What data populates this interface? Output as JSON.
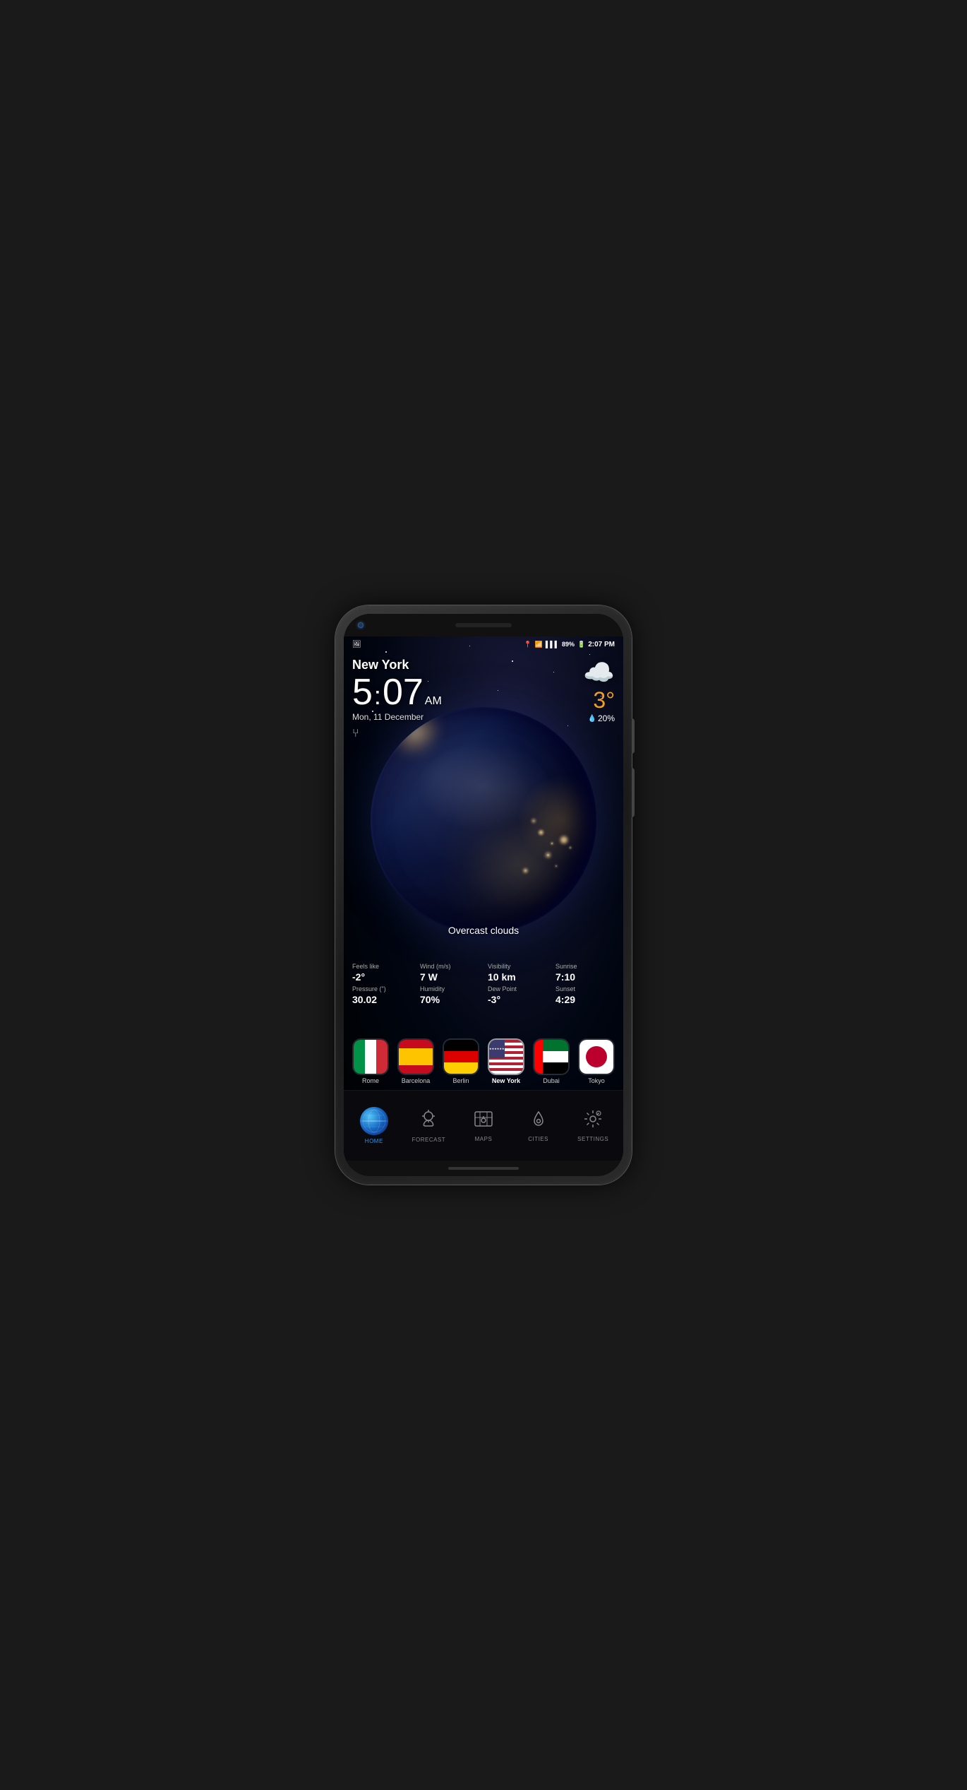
{
  "phone": {
    "statusBar": {
      "battery": "89%",
      "time": "2:07 PM",
      "signal": "●●●",
      "wifi": "wifi"
    },
    "weather": {
      "city": "New York",
      "timeHour": "5",
      "timeMinute": "07",
      "timeAmPm": "AM",
      "date": "Mon, 11 December",
      "temperature": "3°",
      "precipChance": "20%",
      "description": "Overcast clouds",
      "feelsLikeLabel": "Feels like",
      "feelsLikeValue": "-2°",
      "windLabel": "Wind (m/s)",
      "windValue": "7 W",
      "visibilityLabel": "Visibility",
      "visibilityValue": "10 km",
      "sunriseLabel": "Sunrise",
      "sunriseValue": "7:10",
      "pressureLabel": "Pressure (\")",
      "pressureValue": "30.02",
      "humidityLabel": "Humidity",
      "humidityValue": "70%",
      "dewPointLabel": "Dew Point",
      "dewPointValue": "-3°",
      "sunsetLabel": "Sunset",
      "sunsetValue": "4:29"
    },
    "cities": [
      {
        "name": "Rome",
        "flag": "italy",
        "active": false
      },
      {
        "name": "Barcelona",
        "flag": "spain",
        "active": false
      },
      {
        "name": "Berlin",
        "flag": "germany",
        "active": false
      },
      {
        "name": "New York",
        "flag": "usa",
        "active": true
      },
      {
        "name": "Dubai",
        "flag": "uae",
        "active": false
      },
      {
        "name": "Tokyo",
        "flag": "japan",
        "active": false
      }
    ],
    "nav": [
      {
        "id": "home",
        "label": "HOME",
        "active": true
      },
      {
        "id": "forecast",
        "label": "FORECAST",
        "active": false
      },
      {
        "id": "maps",
        "label": "MAPS",
        "active": false
      },
      {
        "id": "cities",
        "label": "CITIES",
        "active": false
      },
      {
        "id": "settings",
        "label": "SETTINGS",
        "active": false
      }
    ]
  }
}
